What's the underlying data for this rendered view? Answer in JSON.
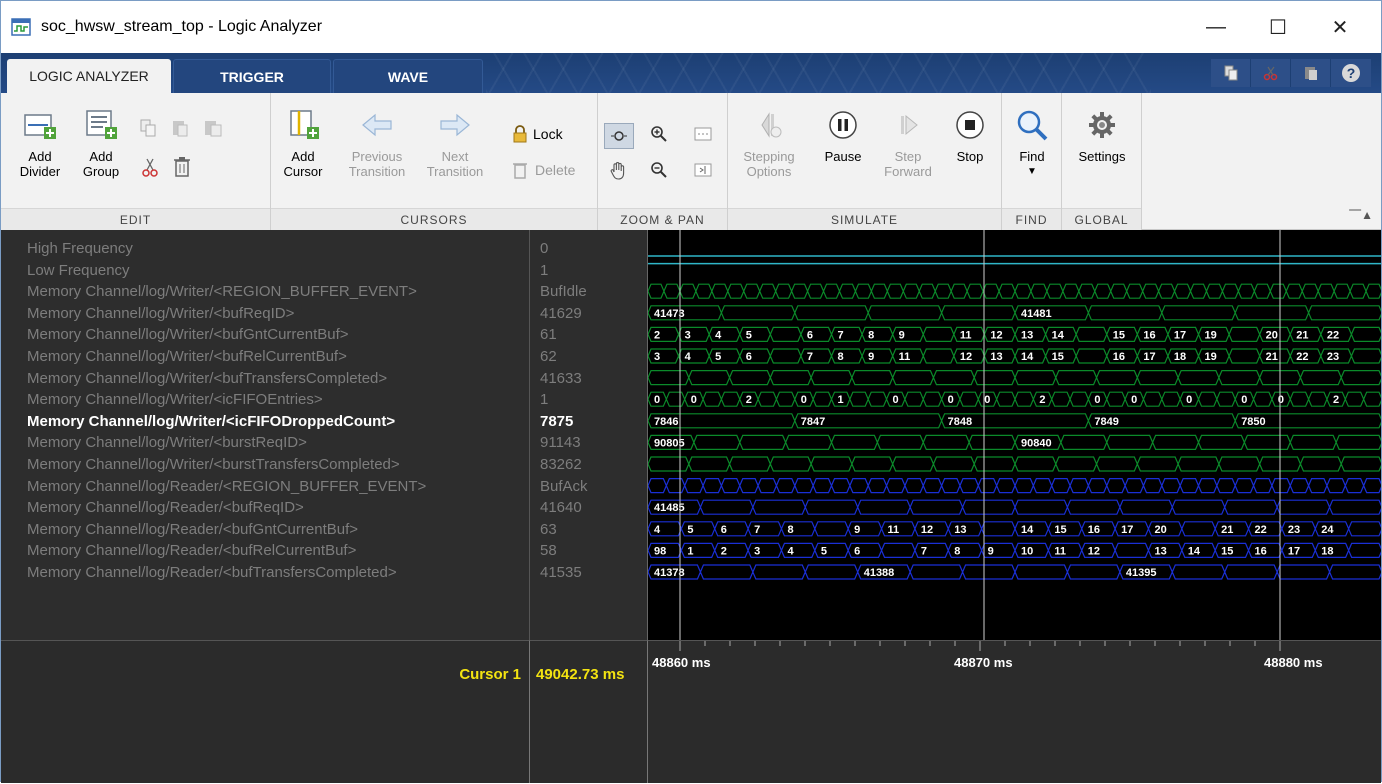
{
  "window": {
    "title": "soc_hwsw_stream_top - Logic Analyzer",
    "minimize": "—",
    "maximize": "☐",
    "close": "✕"
  },
  "tabs": [
    {
      "label": "LOGIC ANALYZER",
      "active": true
    },
    {
      "label": "TRIGGER",
      "active": false
    },
    {
      "label": "WAVE",
      "active": false
    }
  ],
  "quick_access": [
    {
      "icon": "copy-icon"
    },
    {
      "icon": "cut-icon"
    },
    {
      "icon": "paste-icon"
    },
    {
      "icon": "help-icon",
      "label": "?"
    }
  ],
  "ribbon": {
    "edit": {
      "label": "EDIT",
      "add_divider": "Add\nDivider",
      "add_divider_l1": "Add",
      "add_divider_l2": "Divider",
      "add_group_l1": "Add",
      "add_group_l2": "Group"
    },
    "cursors": {
      "label": "CURSORS",
      "add_cursor_l1": "Add",
      "add_cursor_l2": "Cursor",
      "previous_l1": "Previous",
      "previous_l2": "Transition",
      "next_l1": "Next",
      "next_l2": "Transition",
      "lock": "Lock",
      "delete": "Delete"
    },
    "zoom_pan": {
      "label": "ZOOM & PAN"
    },
    "simulate": {
      "label": "SIMULATE",
      "stepping_l1": "Stepping",
      "stepping_l2": "Options",
      "pause": "Pause",
      "step_l1": "Step",
      "step_l2": "Forward",
      "stop": "Stop"
    },
    "find": {
      "label": "FIND",
      "find": "Find"
    },
    "global": {
      "label": "GLOBAL",
      "settings": "Settings"
    }
  },
  "signals": [
    {
      "name": "High Frequency",
      "value": "0",
      "highlight": false
    },
    {
      "name": "Low Frequency",
      "value": "1",
      "highlight": false
    },
    {
      "name": "Memory Channel/log/Writer/<REGION_BUFFER_EVENT>",
      "value": "BufIdle",
      "highlight": false
    },
    {
      "name": "Memory Channel/log/Writer/<bufReqID>",
      "value": "41629",
      "highlight": false
    },
    {
      "name": "Memory Channel/log/Writer/<bufGntCurrentBuf>",
      "value": "61",
      "highlight": false
    },
    {
      "name": "Memory Channel/log/Writer/<bufRelCurrentBuf>",
      "value": "62",
      "highlight": false
    },
    {
      "name": "Memory Channel/log/Writer/<bufTransfersCompleted>",
      "value": "41633",
      "highlight": false
    },
    {
      "name": "Memory Channel/log/Writer/<icFIFOEntries>",
      "value": "1",
      "highlight": false
    },
    {
      "name": "Memory Channel/log/Writer/<icFIFODroppedCount>",
      "value": "7875",
      "highlight": true
    },
    {
      "name": "Memory Channel/log/Writer/<burstReqID>",
      "value": "91143",
      "highlight": false
    },
    {
      "name": "Memory Channel/log/Writer/<burstTransfersCompleted>",
      "value": "83262",
      "highlight": false
    },
    {
      "name": "Memory Channel/log/Reader/<REGION_BUFFER_EVENT>",
      "value": "BufAck",
      "highlight": false
    },
    {
      "name": "Memory Channel/log/Reader/<bufReqID>",
      "value": "41640",
      "highlight": false
    },
    {
      "name": "Memory Channel/log/Reader/<bufGntCurrentBuf>",
      "value": "63",
      "highlight": false
    },
    {
      "name": "Memory Channel/log/Reader/<bufRelCurrentBuf>",
      "value": "58",
      "highlight": false
    },
    {
      "name": "Memory Channel/log/Reader/<bufTransfersCompleted>",
      "value": "41535",
      "highlight": false
    }
  ],
  "wave_labels": {
    "w_reqid": [
      "41473",
      "41481"
    ],
    "w_gnt": [
      "2",
      "3",
      "4",
      "5",
      "6",
      "7",
      "8",
      "9",
      "11",
      "12",
      "13",
      "14",
      "15",
      "16",
      "17",
      "19",
      "20",
      "21",
      "22"
    ],
    "w_rel": [
      "3",
      "4",
      "5",
      "6",
      "7",
      "8",
      "9",
      "11",
      "12",
      "13",
      "14",
      "15",
      "16",
      "17",
      "18",
      "19",
      "21",
      "22",
      "23"
    ],
    "w_fifo": [
      "0",
      "0",
      "2",
      "0",
      "1",
      "0",
      "0",
      "0",
      "2",
      "0",
      "0",
      "0",
      "0",
      "0",
      "2"
    ],
    "w_dropped": [
      "7846",
      "7847",
      "7848",
      "7849",
      "7850"
    ],
    "w_burst": [
      "90805",
      "90840"
    ],
    "r_reqid": [
      "41485"
    ],
    "r_gnt": [
      "4",
      "5",
      "6",
      "7",
      "8",
      "9",
      "11",
      "12",
      "13",
      "14",
      "15",
      "16",
      "17",
      "20",
      "21",
      "22",
      "23",
      "24"
    ],
    "r_rel": [
      "98",
      "1",
      "2",
      "3",
      "4",
      "5",
      "6",
      "7",
      "8",
      "9",
      "10",
      "11",
      "12",
      "13",
      "14",
      "15",
      "16",
      "17",
      "18"
    ],
    "r_trans": [
      "41378",
      "41388",
      "41395"
    ]
  },
  "timeline": {
    "ticks": [
      "48860 ms",
      "48870 ms",
      "48880 ms"
    ],
    "cursor_label": "Cursor 1",
    "cursor_value": "49042.73 ms"
  },
  "colors": {
    "writer_bus": "#0b8a2a",
    "reader_bus": "#1a2fd6",
    "freq_line": "#2fb6c8",
    "cursor": "#f3e311"
  }
}
